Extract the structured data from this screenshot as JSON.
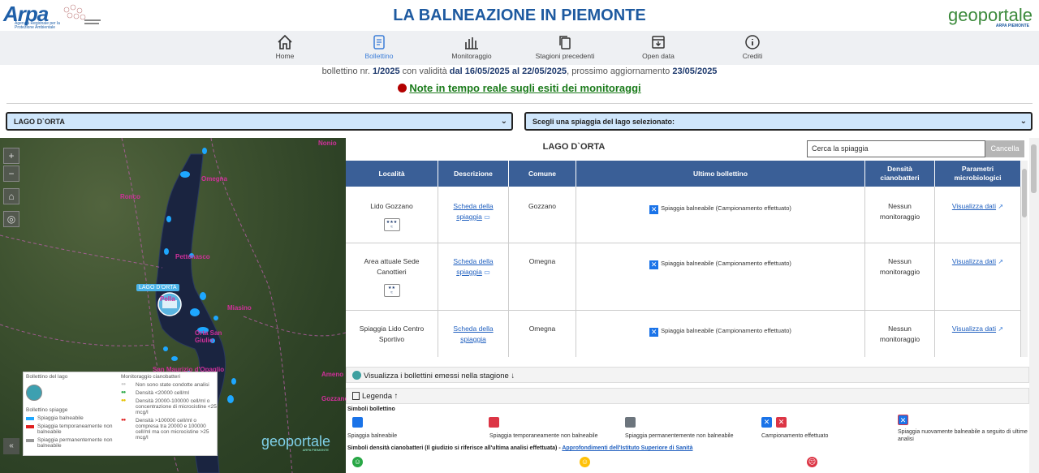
{
  "header": {
    "title": "LA BALNEAZIONE IN PIEMONTE",
    "logo_left": "Arpa",
    "logo_left_sub": "Agenzia Regionale per la Protezione Ambientale",
    "logo_right": "geoportale",
    "logo_right_sub": "ARPA PIEMONTE"
  },
  "nav": [
    {
      "label": "Home",
      "icon": "home-icon"
    },
    {
      "label": "Bollettino",
      "icon": "document-icon",
      "active": true
    },
    {
      "label": "Monitoraggio",
      "icon": "bar-chart-icon"
    },
    {
      "label": "Stagioni precedenti",
      "icon": "copy-icon"
    },
    {
      "label": "Open data",
      "icon": "download-box-icon"
    },
    {
      "label": "Crediti",
      "icon": "info-icon"
    }
  ],
  "bulletin": {
    "prefix": "bollettino nr.",
    "number": "1/2025",
    "validity_text": "con validità",
    "validity": "dal 16/05/2025 al 22/05/2025",
    "next_text": ", prossimo aggiornamento",
    "next_date": "23/05/2025"
  },
  "note_link": "Note in tempo reale sugli esiti dei monitoraggi",
  "selects": {
    "lake": "LAGO D`ORTA",
    "beach": "Scegli una spiaggia del lago selezionato:"
  },
  "map": {
    "labels": [
      "Omegna",
      "Pella",
      "Pettenasco",
      "Miasino",
      "Orta San Giulio",
      "San Maurizio d'Opaglio",
      "Ameno",
      "Gozzano",
      "Ronco"
    ],
    "callout": "LAGO D'ORTA",
    "controls": [
      "+",
      "−",
      "⌂",
      "◎"
    ],
    "collapse": "«",
    "legend": {
      "title_lake": "Bollettino del lago",
      "title_beaches": "Bollettino spiagge",
      "beach_items": [
        "Spiaggia balneabile",
        "Spiaggia temporaneamente non balneabile",
        "Spiaggia permanentemente non balneabile"
      ],
      "title_cyano": "Monitoraggio cianobatteri",
      "cyano_items": [
        "Non sono state condotte analisi",
        "Densità <20000 cell/ml",
        "Densità 20000-100000 cell/ml o concentrazione di microcistine <25 mcg/l",
        "Densità >100000 cell/ml o compresa tra 20000 e 100000 cell/ml ma con microcistine >25 mcg/l"
      ]
    },
    "watermark": "geoportale",
    "watermark_sub": "ARPA PIEMONTE"
  },
  "panel": {
    "title": "LAGO D`ORTA",
    "search_placeholder": "Cerca la spiaggia",
    "cancel": "Cancella"
  },
  "table": {
    "headers": [
      "Località",
      "Descrizione",
      "Comune",
      "Ultimo bollettino",
      "Densità cianobatteri",
      "Parametri microbiologici"
    ],
    "rows": [
      {
        "localita": "Lido Gozzano",
        "descrizione": "Scheda della spiaggia",
        "comune": "Gozzano",
        "bollettino": "Spiaggia balneabile (Campionamento effettuato)",
        "densita": "Nessun monitoraggio",
        "parametri": "Visualizza dati",
        "stars": "★★★"
      },
      {
        "localita": "Area attuale Sede Canottieri",
        "descrizione": "Scheda della spiaggia",
        "comune": "Omegna",
        "bollettino": "Spiaggia balneabile (Campionamento effettuato)",
        "densita": "Nessun monitoraggio",
        "parametri": "Visualizza dati",
        "stars": "★★"
      },
      {
        "localita": "Spiaggia Lido Centro Sportivo",
        "descrizione": "Scheda della spiaggia",
        "comune": "Omegna",
        "bollettino": "Spiaggia balneabile (Campionamento effettuato)",
        "densita": "Nessun monitoraggio",
        "parametri": "Visualizza dati",
        "stars": "★★"
      }
    ]
  },
  "sections": {
    "history": "Visualizza i bollettini emessi nella stagione ↓",
    "legend": "Legenda ↑"
  },
  "legend": {
    "symbols_title": "Simboli bollettino",
    "items": [
      {
        "label": "Spiaggia balneabile",
        "color": "#1a73e8"
      },
      {
        "label": "Spiaggia temporaneamente non balneabile",
        "color": "#dc3545"
      },
      {
        "label": "Spiaggia permanentemente non balneabile",
        "color": "#6c757d"
      },
      {
        "label": "Campionamento effettuato",
        "color": "#1a73e8"
      },
      {
        "label": "Spiaggia nuovamente balneabile a seguito di ultime analisi",
        "color": "#1a73e8"
      }
    ],
    "cyano_title": "Simboli densità cianobatteri (Il giudizio si riferisce all'ultima analisi effettuata) -",
    "cyano_link": "Approfondimenti dell'Istituto Superiore di Sanità",
    "faces": [
      "#28a745",
      "#ffc107",
      "#dc3545"
    ]
  }
}
